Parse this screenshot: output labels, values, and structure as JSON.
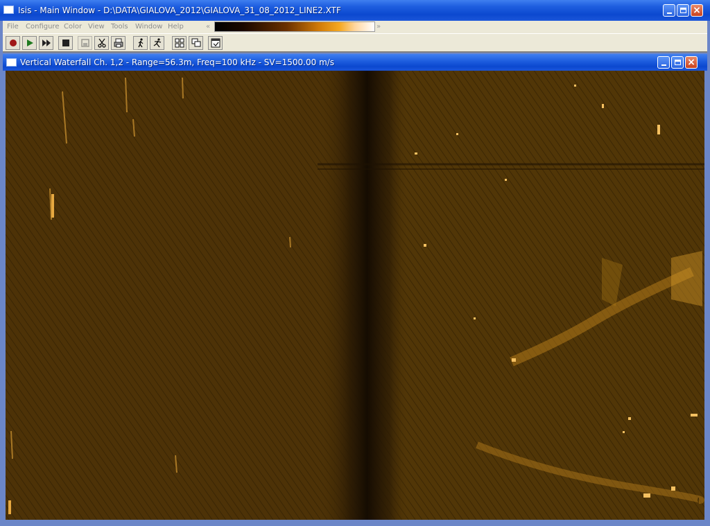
{
  "main_window": {
    "title": "Isis - Main Window - D:\\DATA\\GIALOVA_2012\\GIALOVA_31_08_2012_LINE2.XTF"
  },
  "menu": {
    "items": [
      "File",
      "Configure",
      "Color",
      "View",
      "Tools",
      "Window",
      "Help"
    ],
    "palette_left": "«",
    "palette_right": "»"
  },
  "toolbar": {
    "buttons": [
      "record-icon",
      "play-icon",
      "fast-forward-icon",
      "stop-icon",
      "save-icon",
      "scissors-icon",
      "printer-icon",
      "walk-icon",
      "run-icon",
      "tile-windows-icon",
      "cascade-windows-icon",
      "window-icon"
    ]
  },
  "child_window": {
    "title": "Vertical Waterfall Ch. 1,2 - Range=56.3m, Freq=100 kHz - SV=1500.00 m/s"
  },
  "colors": {
    "titlebar": "#1f5fe0",
    "sonar_base": "#4e3306",
    "sonar_highlight": "#f5b030",
    "nadir": "#1e1203"
  }
}
